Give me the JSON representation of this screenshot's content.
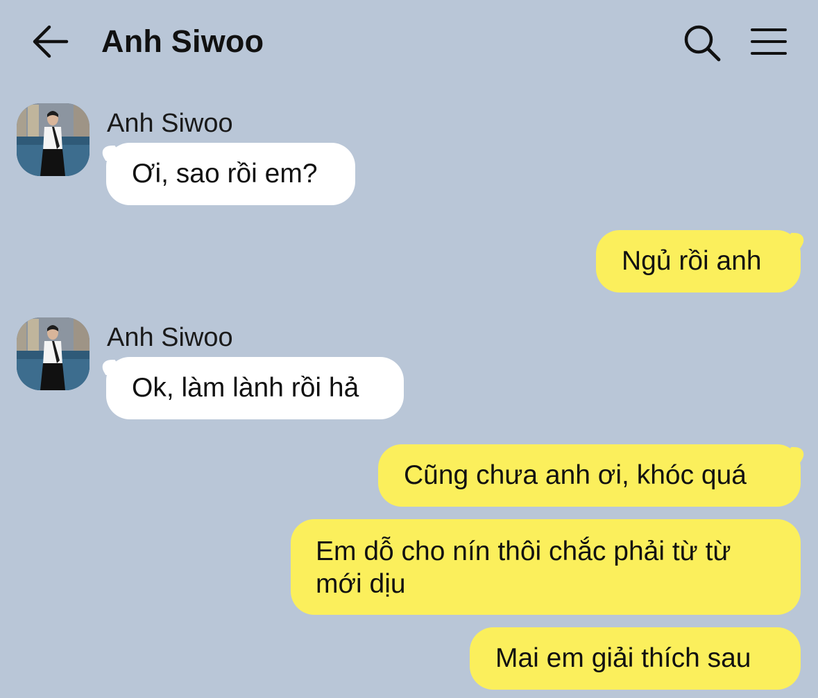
{
  "header": {
    "title": "Anh Siwoo",
    "back_icon": "arrow-left-icon",
    "search_icon": "search-icon",
    "menu_icon": "hamburger-menu-icon"
  },
  "colors": {
    "background": "#b9c6d7",
    "incoming_bubble": "#ffffff",
    "outgoing_bubble": "#fbef5c"
  },
  "messages": [
    {
      "direction": "incoming",
      "sender": "Anh Siwoo",
      "text": "Ơi, sao rồi em?"
    },
    {
      "direction": "outgoing",
      "text": "Ngủ rồi anh"
    },
    {
      "direction": "incoming",
      "sender": "Anh Siwoo",
      "text": "Ok, làm lành rồi hả"
    },
    {
      "direction": "outgoing",
      "text": "Cũng chưa anh ơi, khóc quá"
    },
    {
      "direction": "outgoing",
      "text": "Em dỗ cho nín thôi chắc phải từ từ mới dịu"
    },
    {
      "direction": "outgoing",
      "text": "Mai em giải thích sau"
    }
  ]
}
